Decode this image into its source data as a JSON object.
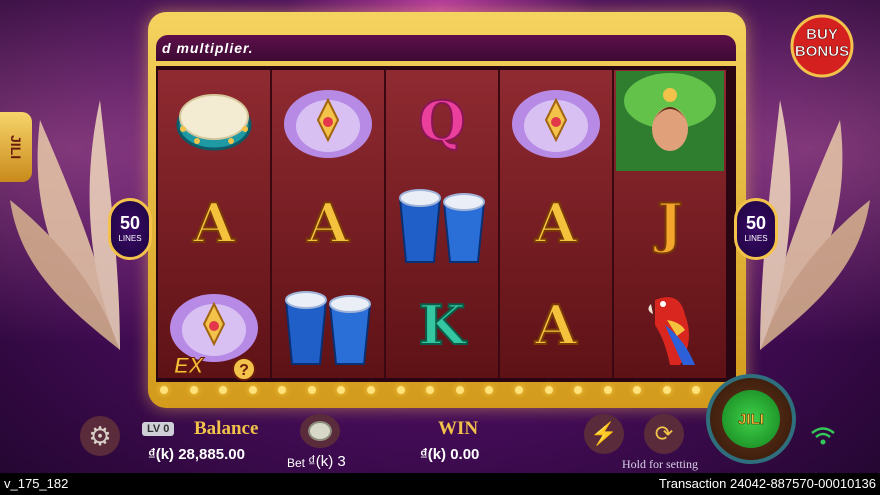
{
  "marquee_text": "d multiplier.",
  "buy_bonus": {
    "line1": "BUY",
    "line2": "BONUS"
  },
  "side_tab": "JILI",
  "lines_left": {
    "count": "50",
    "label": "LINES"
  },
  "lines_right": {
    "count": "50",
    "label": "LINES"
  },
  "reels": [
    [
      "tambourine",
      "A",
      "feather-headdress"
    ],
    [
      "feather-headdress",
      "A",
      "conga-drums"
    ],
    [
      "Q",
      "conga-drums",
      "K"
    ],
    [
      "feather-headdress",
      "A",
      "A"
    ],
    [
      "samba-dancer",
      "J",
      "parrot"
    ]
  ],
  "ex_badge": {
    "text": "EX",
    "help": "?"
  },
  "hud": {
    "level": "LV 0",
    "balance_label": "Balance",
    "balance_value": "₫(k) 28,885.00",
    "bet_label": "Bet",
    "bet_value": "₫(k) 3",
    "win_label": "WIN",
    "win_value": "₫(k) 0.00",
    "hold_hint": "Hold for setting",
    "spin_logo": "JILI"
  },
  "status": {
    "version": "v_175_182",
    "transaction": "Transaction 24042-887570-00010136"
  },
  "colors": {
    "gold": "#f2c24a",
    "reel": "#8f2a31",
    "panel": "#4a0d5e",
    "accent": "#ea3f9a"
  }
}
